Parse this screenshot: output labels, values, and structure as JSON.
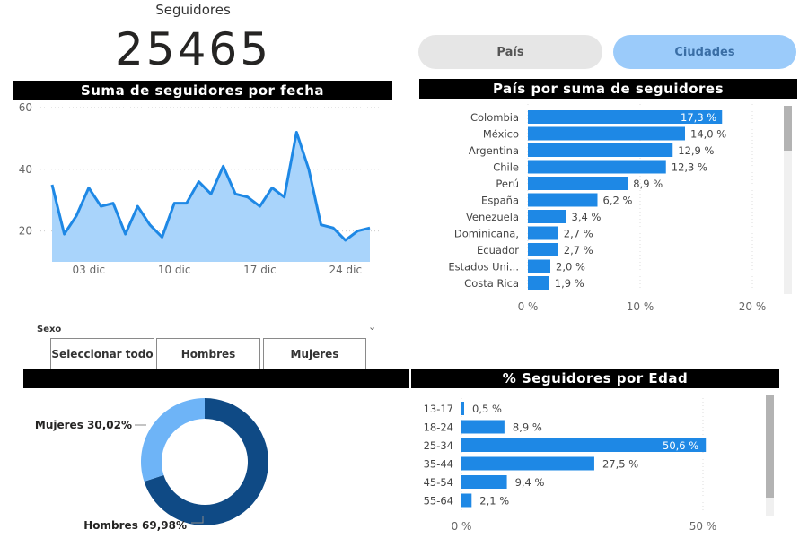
{
  "kpi": {
    "label": "Seguidores",
    "value": "25465"
  },
  "toggle": {
    "pais_label": "País",
    "ciudades_label": "Ciudades"
  },
  "colors": {
    "accent": "#1e88e5",
    "area_fill": "#a9d4fb",
    "donut_dark": "#0f4a85",
    "donut_light": "#6eb4f7",
    "header_bg": "#000000"
  },
  "line_chart": {
    "title": "Suma de seguidores por fecha",
    "chart_data": {
      "type": "area",
      "title": "Suma de seguidores por fecha",
      "yticks": [
        "20",
        "40",
        "60"
      ],
      "ylim": [
        10,
        60
      ],
      "xticks": [
        "03 dic",
        "10 dic",
        "17 dic",
        "24 dic"
      ],
      "x": [
        "30 nov",
        "01 dic",
        "02 dic",
        "03 dic",
        "04 dic",
        "05 dic",
        "06 dic",
        "07 dic",
        "08 dic",
        "09 dic",
        "10 dic",
        "11 dic",
        "12 dic",
        "13 dic",
        "14 dic",
        "15 dic",
        "16 dic",
        "17 dic",
        "18 dic",
        "19 dic",
        "20 dic",
        "21 dic",
        "22 dic",
        "23 dic",
        "24 dic",
        "25 dic",
        "26 dic"
      ],
      "values": [
        35,
        19,
        25,
        34,
        28,
        29,
        19,
        28,
        22,
        18,
        29,
        29,
        36,
        32,
        41,
        32,
        31,
        28,
        34,
        31,
        52,
        40,
        22,
        21,
        17,
        20,
        21
      ],
      "grid": true
    }
  },
  "country_chart": {
    "title": "País por suma de seguidores",
    "chart_data": {
      "type": "bar",
      "orientation": "horizontal",
      "categories": [
        "Colombia",
        "México",
        "Argentina",
        "Chile",
        "Perú",
        "España",
        "Venezuela",
        "Dominicana,",
        "Ecuador",
        "Estados Uni...",
        "Costa Rica"
      ],
      "values": [
        17.3,
        14.0,
        12.9,
        12.3,
        8.9,
        6.2,
        3.4,
        2.7,
        2.7,
        2.0,
        1.9
      ],
      "labels": [
        "17,3 %",
        "14,0 %",
        "12,9 %",
        "12,3 %",
        "8,9 %",
        "6,2 %",
        "3,4 %",
        "2,7 %",
        "2,7 %",
        "2,0 %",
        "1,9 %"
      ],
      "xticks": [
        "0 %",
        "10 %",
        "20 %"
      ],
      "xlim": [
        0,
        20
      ],
      "grid": true
    }
  },
  "slicer": {
    "title": "Sexo",
    "options": [
      "Seleccionar todo",
      "Hombres",
      "Mujeres"
    ]
  },
  "donut_chart": {
    "chart_data": {
      "type": "pie",
      "categories": [
        "Hombres",
        "Mujeres"
      ],
      "values": [
        69.98,
        30.02
      ],
      "labels": [
        "Hombres 69,98%",
        "Mujeres 30,02%"
      ]
    }
  },
  "age_chart": {
    "title": "% Seguidores por Edad",
    "chart_data": {
      "type": "bar",
      "orientation": "horizontal",
      "categories": [
        "13-17",
        "18-24",
        "25-34",
        "35-44",
        "45-54",
        "55-64"
      ],
      "values": [
        0.5,
        8.9,
        50.6,
        27.5,
        9.4,
        2.1
      ],
      "labels": [
        "0,5 %",
        "8,9 %",
        "50,6 %",
        "27,5 %",
        "9,4 %",
        "2,1 %"
      ],
      "xticks": [
        "0 %",
        "50 %"
      ],
      "xlim": [
        0,
        50
      ],
      "grid": true
    }
  }
}
